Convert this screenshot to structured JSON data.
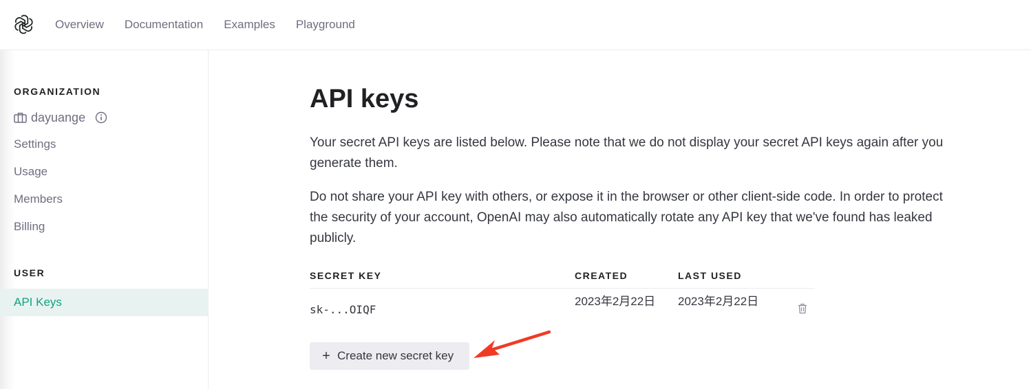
{
  "nav": {
    "logo": "openai-logo-icon",
    "links": [
      "Overview",
      "Documentation",
      "Examples",
      "Playground"
    ]
  },
  "sidebar": {
    "organization_title": "ORGANIZATION",
    "org_name": "dayuange",
    "org_icon": "briefcase-icon",
    "info_icon": "info-icon",
    "items": [
      "Settings",
      "Usage",
      "Members",
      "Billing"
    ],
    "user_title": "USER",
    "active_item": "API Keys"
  },
  "main": {
    "title": "API keys",
    "para1": "Your secret API keys are listed below. Please note that we do not display your secret API keys again after you generate them.",
    "para2": "Do not share your API key with others, or expose it in the browser or other client-side code. In order to protect the security of your account, OpenAI may also automatically rotate any API key that we've found has leaked publicly.",
    "table": {
      "headers": [
        "SECRET KEY",
        "CREATED",
        "LAST USED"
      ],
      "rows": [
        {
          "key": "sk-...OIQF",
          "created": "2023年2月22日",
          "last_used": "2023年2月22日",
          "action_icon": "trash-icon"
        }
      ]
    },
    "create_button": "Create new secret key"
  },
  "colors": {
    "accent": "#10a37f",
    "active_bg": "#e8f3f1",
    "annotation_arrow": "#f03a24"
  }
}
